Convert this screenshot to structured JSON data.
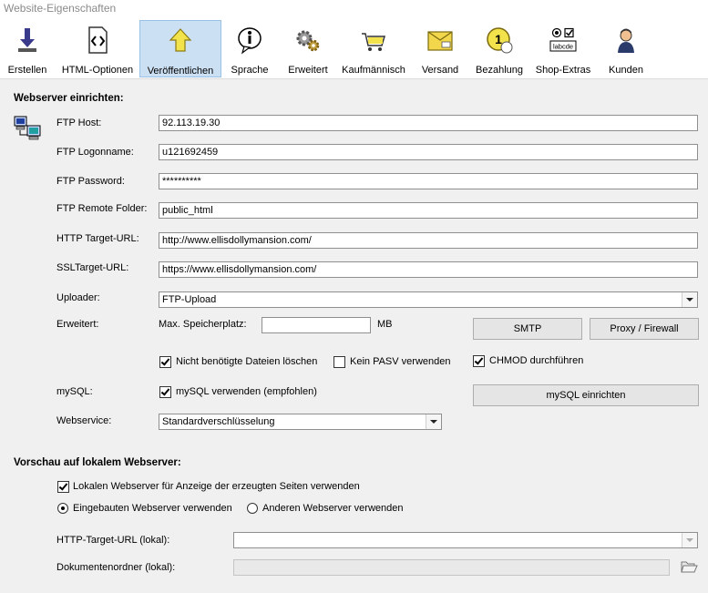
{
  "window": {
    "title": "Website-Eigenschaften"
  },
  "toolbar": {
    "items": [
      {
        "label": "Erstellen",
        "icon": "download-arrow-icon"
      },
      {
        "label": "HTML-Optionen",
        "icon": "html-code-icon"
      },
      {
        "label": "Veröffentlichen",
        "icon": "upload-arrow-icon",
        "active": true
      },
      {
        "label": "Sprache",
        "icon": "info-bubble-icon"
      },
      {
        "label": "Erweitert",
        "icon": "gears-icon"
      },
      {
        "label": "Kaufmännisch",
        "icon": "shopping-cart-icon"
      },
      {
        "label": "Versand",
        "icon": "package-icon"
      },
      {
        "label": "Bezahlung",
        "icon": "coin-icon"
      },
      {
        "label": "Shop-Extras",
        "icon": "form-controls-icon",
        "icon_text": "labcde"
      },
      {
        "label": "Kunden",
        "icon": "customer-icon"
      }
    ]
  },
  "webserver": {
    "heading": "Webserver einrichten:",
    "ftp_host_label": "FTP Host:",
    "ftp_host": "92.113.19.30",
    "ftp_login_label": "FTP Logonname:",
    "ftp_login": "u121692459",
    "ftp_password_label": "FTP Password:",
    "ftp_password": "**********",
    "ftp_folder_label": "FTP Remote Folder:",
    "ftp_folder": "public_html",
    "http_url_label": "HTTP Target-URL:",
    "http_url": "http://www.ellisdollymansion.com/",
    "ssl_url_label": "SSLTarget-URL:",
    "ssl_url": "https://www.ellisdollymansion.com/",
    "uploader_label": "Uploader:",
    "uploader": "FTP-Upload",
    "erweitert_label": "Erweitert:",
    "max_storage_label": "Max. Speicherplatz:",
    "max_storage": "",
    "max_storage_unit": "MB",
    "smtp_button": "SMTP",
    "proxy_button": "Proxy / Firewall",
    "delete_unneeded_label": "Nicht benötigte Dateien löschen",
    "delete_unneeded": true,
    "no_pasv_label": "Kein PASV verwenden",
    "no_pasv": false,
    "chmod_label": "CHMOD durchführen",
    "chmod": true,
    "mysql_label": "mySQL:",
    "mysql_use_label": "mySQL verwenden (empfohlen)",
    "mysql_use": true,
    "mysql_button": "mySQL einrichten",
    "webservice_label": "Webservice:",
    "webservice": "Standardverschlüsselung"
  },
  "preview": {
    "heading": "Vorschau auf lokalem Webserver:",
    "use_local_label": "Lokalen Webserver für Anzeige der erzeugten Seiten verwenden",
    "use_local": true,
    "builtin_label": "Eingebauten Webserver verwenden",
    "other_label": "Anderen Webserver verwenden",
    "selected": "builtin",
    "local_url_label": "HTTP-Target-URL (lokal):",
    "local_url": "",
    "docroot_label": "Dokumentenordner (lokal):",
    "docroot": ""
  }
}
